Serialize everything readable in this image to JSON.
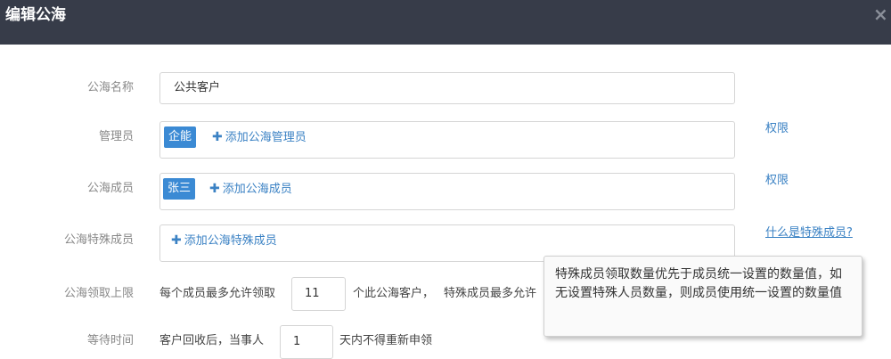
{
  "dialog": {
    "title": "编辑公海",
    "close_icon": "×"
  },
  "form": {
    "name": {
      "label": "公海名称",
      "value": "公共客户"
    },
    "admins": {
      "label": "管理员",
      "tags": [
        "企能"
      ],
      "add_label": "添加公海管理员",
      "side_link": "权限"
    },
    "members": {
      "label": "公海成员",
      "tags": [
        "张三"
      ],
      "add_label": "添加公海成员",
      "side_link": "权限"
    },
    "special_members": {
      "label": "公海特殊成员",
      "add_label": "添加公海特殊成员",
      "side_link": "什么是特殊成员?"
    },
    "claim_limit": {
      "label": "公海领取上限",
      "prefix": "每个成员最多允许领取",
      "value": "11",
      "suffix": "个此公海客户，",
      "special_prefix": "特殊成员最多允许"
    },
    "wait_time": {
      "label": "等待时间",
      "prefix": "客户回收后，当事人",
      "value": "1",
      "suffix": "天内不得重新申领"
    }
  },
  "tooltip": {
    "text": "特殊成员领取数量优先于成员统一设置的数量值，如无设置特殊人员数量，则成员使用统一设置的数量值"
  },
  "colors": {
    "header_bg": "#373c49",
    "accent": "#3b8ad4",
    "link": "#3b82c4"
  }
}
